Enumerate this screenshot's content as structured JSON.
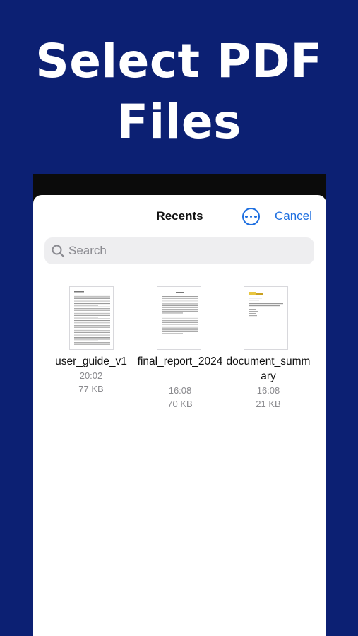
{
  "headline": {
    "line1": "Select PDF",
    "line2": "Files"
  },
  "sheet": {
    "title": "Recents",
    "more_icon": "ellipsis-circle-icon",
    "cancel_label": "Cancel"
  },
  "search": {
    "placeholder": "Search",
    "value": "",
    "icon": "magnifier-icon"
  },
  "files": [
    {
      "name": "user_guide_v1",
      "time": "20:02",
      "size": "77 KB"
    },
    {
      "name": "final_report_2024",
      "time": "16:08",
      "size": "70 KB"
    },
    {
      "name": "document_summary",
      "time": "16:08",
      "size": "21 KB"
    }
  ],
  "colors": {
    "background": "#0c2073",
    "accent": "#1e6fe0",
    "search_bg": "#eeeef0",
    "secondary_text": "#8a8a8e"
  }
}
